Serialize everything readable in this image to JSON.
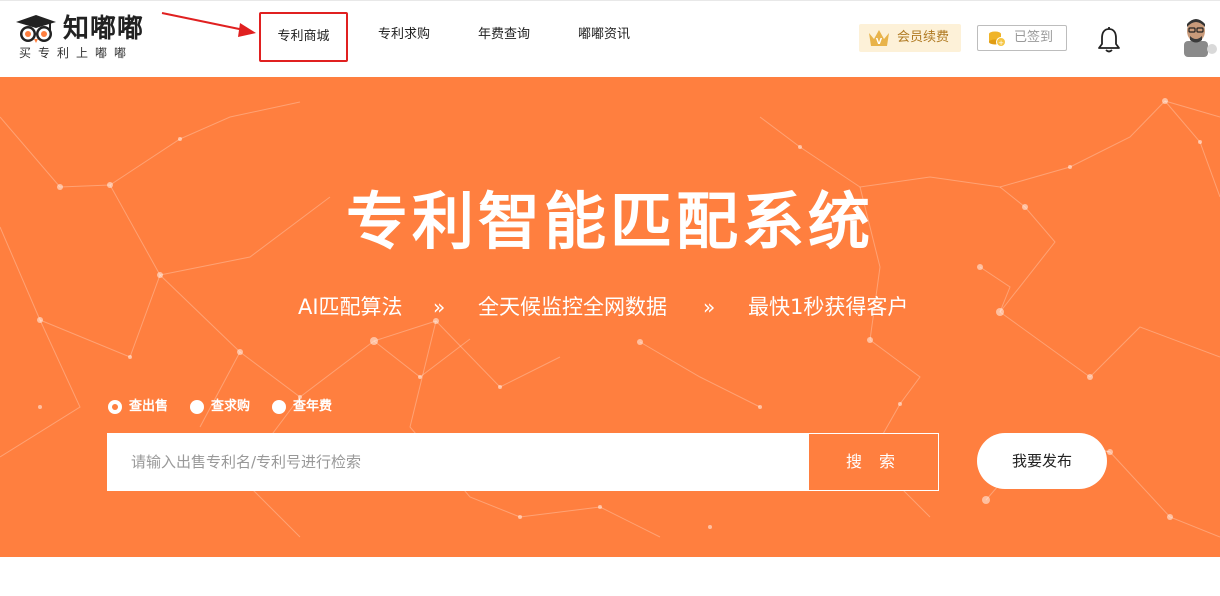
{
  "logo": {
    "name": "知嘟嘟",
    "slogan": "买专利上嘟嘟"
  },
  "nav": [
    {
      "label": "专利商城",
      "active": true
    },
    {
      "label": "专利求购",
      "active": false
    },
    {
      "label": "年费查询",
      "active": false
    },
    {
      "label": "嘟嘟资讯",
      "active": false
    }
  ],
  "header": {
    "vip_label": "会员续费",
    "signed_label": "已签到"
  },
  "banner": {
    "title": "专利智能匹配系统",
    "slogans": [
      "AI匹配算法",
      "全天候监控全网数据",
      "最快1秒获得客户"
    ],
    "separator": "»"
  },
  "search": {
    "options": [
      {
        "label": "查出售",
        "checked": true
      },
      {
        "label": "查求购",
        "checked": false
      },
      {
        "label": "查年费",
        "checked": false
      }
    ],
    "placeholder": "请输入出售专利名/专利号进行检索",
    "button_label": "搜 索",
    "publish_label": "我要发布"
  },
  "colors": {
    "brand_orange": "#ff7f3f",
    "annotation_red": "#e02020",
    "vip_gold": "#b07a22"
  }
}
